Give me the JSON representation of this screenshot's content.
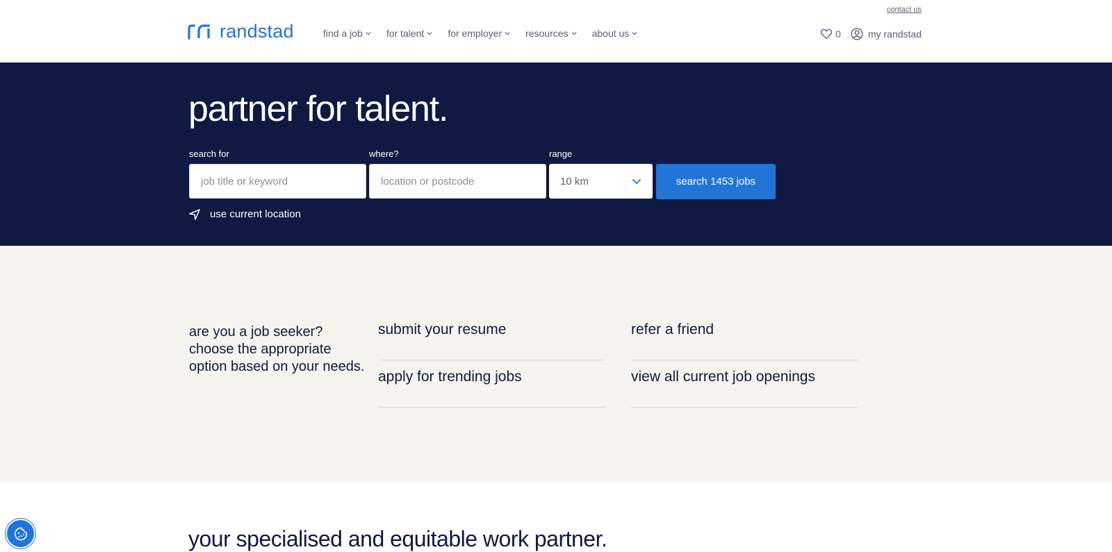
{
  "header": {
    "contact_link": "contact us",
    "logo_text": "randstad",
    "nav": [
      {
        "label": "find a job"
      },
      {
        "label": "for talent"
      },
      {
        "label": "for employer"
      },
      {
        "label": "resources"
      },
      {
        "label": "about us"
      }
    ],
    "favorites_count": "0",
    "account_label": "my randstad"
  },
  "hero": {
    "title": "partner for talent.",
    "search_label": "search for",
    "search_placeholder": "job title or keyword",
    "where_label": "where?",
    "where_placeholder": "location or postcode",
    "range_label": "range",
    "range_value": "10 km",
    "search_button": "search 1453 jobs",
    "use_location": "use current location"
  },
  "options": {
    "intro": "are you a job seeker? choose the appropriate option based on your needs.",
    "col1": [
      "submit your resume",
      "apply for trending jobs"
    ],
    "col2": [
      "refer a friend",
      "view all current job openings"
    ]
  },
  "bottom": {
    "title": "your specialised and equitable work partner."
  },
  "colors": {
    "brand_blue": "#2175d9",
    "navy": "#0f1941",
    "beige": "#f5f4ef"
  }
}
